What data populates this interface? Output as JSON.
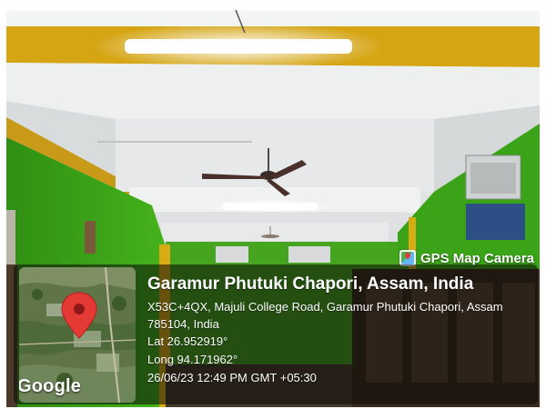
{
  "app_badge": {
    "label": "GPS Map Camera",
    "icon": "gps-map-camera-icon"
  },
  "location": {
    "title": "Garamur Phutuki Chapori, Assam, India",
    "address": "X53C+4QX, Majuli College Road, Garamur Phutuki Chapori, Assam 785104, India",
    "lat": "Lat 26.952919°",
    "long": "Long 94.171962°",
    "datetime": "26/06/23 12:49 PM GMT +05:30"
  },
  "map": {
    "provider_label": "Google",
    "marker_icon": "map-pin-icon",
    "marker_color": "#e53935"
  },
  "colors": {
    "wall": "#3aa317",
    "trim": "#d8aa14",
    "ceiling": "#e9eced"
  }
}
